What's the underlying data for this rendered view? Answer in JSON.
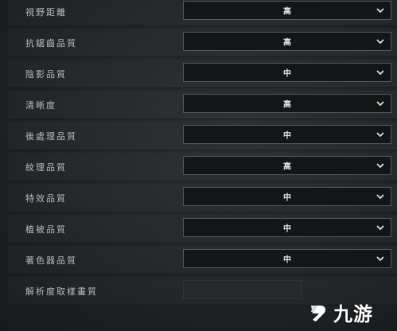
{
  "settings": [
    {
      "label": "視野距離",
      "value": "高"
    },
    {
      "label": "抗鋸齒品質",
      "value": "高"
    },
    {
      "label": "陰影品質",
      "value": "中"
    },
    {
      "label": "清晰度",
      "value": "高"
    },
    {
      "label": "後處理品質",
      "value": "中"
    },
    {
      "label": "紋理品質",
      "value": "高"
    },
    {
      "label": "特效品質",
      "value": "中"
    },
    {
      "label": "植被品質",
      "value": "中"
    },
    {
      "label": "著色器品質",
      "value": "中"
    },
    {
      "label": "解析度取樣畫質",
      "value": ""
    }
  ],
  "icons": {
    "dropdown": "chevron-down-icon",
    "watermark": "jiuyou-logo"
  },
  "watermark": {
    "text": "九游"
  },
  "colors": {
    "background": "#202326",
    "dropdown_bg": "#131516",
    "dropdown_border": "#55595c",
    "label_text": "#b6bcc0",
    "value_text": "#e6e8e9"
  }
}
